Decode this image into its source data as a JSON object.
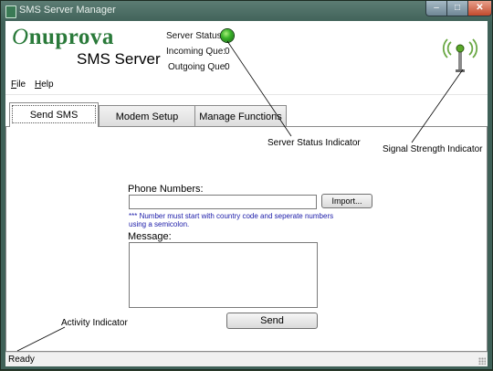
{
  "window": {
    "title": "SMS Server Manager"
  },
  "header": {
    "logo_initial": "O",
    "logo_rest": "nuprova",
    "product_name": "SMS Server",
    "server_status_label": "Server Status:",
    "incoming_label": "Incoming Que:",
    "incoming_value": "0",
    "outgoing_label": "Outgoing Que:",
    "outgoing_value": "0",
    "status_color": "#3bb32a"
  },
  "menu": [
    {
      "label": "File",
      "access_key": "F"
    },
    {
      "label": "Help",
      "access_key": "H"
    }
  ],
  "tabs": [
    {
      "label": "Send SMS",
      "active": true
    },
    {
      "label": "Modem Setup",
      "active": false
    },
    {
      "label": "Manage Functions",
      "active": false
    }
  ],
  "form": {
    "phone_label": "Phone Numbers:",
    "phone_value": "",
    "import_label": "Import...",
    "hint_line1": "*** Number must start with country code and seperate numbers",
    "hint_line2": "using a semicolon.",
    "message_label": "Message:",
    "message_value": "",
    "send_label": "Send"
  },
  "annotations": {
    "server_status": "Server Status Indicator",
    "signal_strength": "Signal Strength Indicator",
    "activity": "Activity Indicator"
  },
  "statusbar": {
    "text": "Ready"
  }
}
